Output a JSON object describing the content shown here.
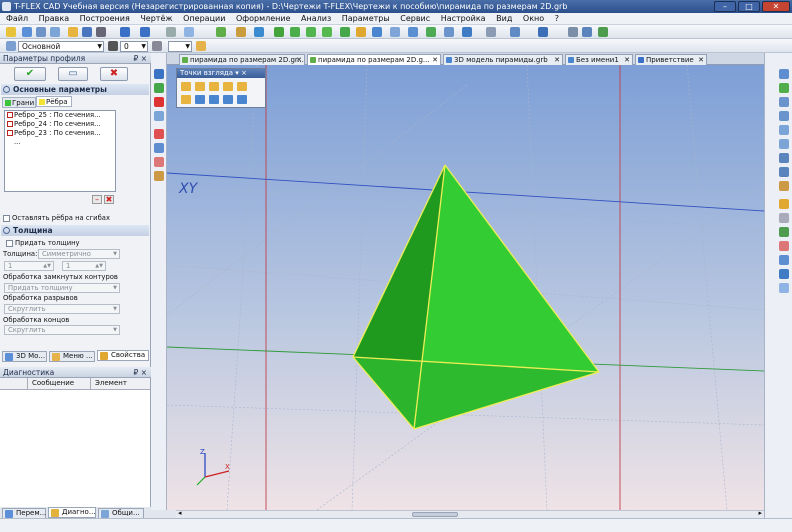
{
  "window": {
    "title": "T-FLEX CAD Учебная версия (Незарегистрированная копия) - D:\\Чертежи T-FLEX\\Чертежи к пособию\\пирамида по размерам 2D.grb",
    "minimize": "–",
    "maximize": "□",
    "close": "✕"
  },
  "menu": [
    "Файл",
    "Правка",
    "Построения",
    "Чертёж",
    "Операции",
    "Оформление",
    "Анализ",
    "Параметры",
    "Сервис",
    "Настройка",
    "Вид",
    "Окно",
    "?"
  ],
  "toolbar2": {
    "layer_combo": "Основной",
    "number_combo": "0"
  },
  "profile_panel": {
    "title": "Параметры профиля",
    "pin": "₽ ×",
    "ok_label": "✔",
    "cancel_label": "✖",
    "main_params": "Основные параметры",
    "tab_faces": "Грани",
    "tab_edges": "Рёбра",
    "edges": [
      "Ребро_25 : По сечения...",
      "Ребро_24 : По сечения...",
      "Ребро_23 : По сечения..."
    ],
    "more": "...",
    "keep_edges": "Оставлять рёбра на сгибах",
    "thickness_head": "Толщина",
    "give_thickness": "Придать толщину",
    "thickness_label": "Толщина:",
    "thickness_value": "Симметрично",
    "val1": "1",
    "val2": "1",
    "closed_contours": "Обработка замкнутых контуров",
    "closed_value": "Придать толщину",
    "gaps": "Обработка разрывов",
    "gaps_value": "Скруглить",
    "ends": "Обработка концов",
    "ends_value": "Скруглить"
  },
  "panel_tabs": [
    "3D Мо...",
    "Меню ...",
    "Свойства"
  ],
  "diagnostics": {
    "title": "Диагностика",
    "pin": "₽ ×",
    "col_message": "Сообщение",
    "col_element": "Элемент"
  },
  "bottom_tabs": [
    "Перем...",
    "Диагно...",
    "Общи..."
  ],
  "doc_tabs": [
    {
      "label": "пирамида по размерам 2D.gr...",
      "active": false
    },
    {
      "label": "пирамида по размерам 2D.g...",
      "active": true
    },
    {
      "label": "3D модель пирамиды.grb",
      "active": false
    },
    {
      "label": "Без имени1",
      "active": false
    },
    {
      "label": "Приветствие",
      "active": false
    }
  ],
  "viewpoints": {
    "title": "Точки взгляда ▾ ×"
  },
  "viewport": {
    "plane_label": "XY",
    "axis_z": "Z",
    "axis_x": "X",
    "scroll_left": "◂",
    "scroll_right": "▸"
  },
  "colors": {
    "pyramid": "#33cc33",
    "pyramid_dark": "#1f9a1f",
    "edge": "#eeee55",
    "grid_red": "#c0404a",
    "grid_blue": "#3050c0"
  }
}
